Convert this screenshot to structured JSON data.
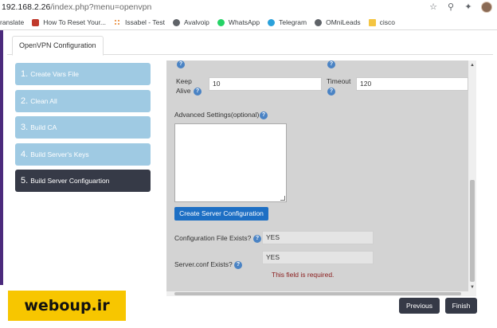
{
  "browser": {
    "url_host": "192.168.2.26",
    "url_path": "/index.php?menu=openvpn",
    "bookmarks": [
      {
        "label": "ranslate",
        "icon": "none"
      },
      {
        "label": "How To Reset Your...",
        "icon": "msft"
      },
      {
        "label": "Issabel - Test",
        "icon": "dots"
      },
      {
        "label": "Avalvoip",
        "icon": "globe"
      },
      {
        "label": "WhatsApp",
        "icon": "wa"
      },
      {
        "label": "Telegram",
        "icon": "tg"
      },
      {
        "label": "OMniLeads",
        "icon": "globe"
      },
      {
        "label": "cisco",
        "icon": "folder"
      }
    ]
  },
  "tab": {
    "label": "OpenVPN Configuration"
  },
  "steps": [
    {
      "num": "1.",
      "label": "Create Vars File"
    },
    {
      "num": "2.",
      "label": "Clean All"
    },
    {
      "num": "3.",
      "label": "Build CA"
    },
    {
      "num": "4.",
      "label": "Build Server's Keys"
    },
    {
      "num": "5.",
      "label": "Build Server Configuartion"
    }
  ],
  "form": {
    "keep_alive_label_1": "Keep",
    "keep_alive_label_2": "Alive",
    "keep_alive_value": "10",
    "timeout_label": "Timeout",
    "timeout_value": "120",
    "advanced_label": "Advanced Settings(optional)",
    "create_button": "Create Server Configuration",
    "config_exists_label": "Configuration File Exists?",
    "config_exists_value": "YES",
    "server_conf_label": "Server.conf Exists?",
    "server_conf_value": "YES",
    "error_text": "This field is required."
  },
  "nav": {
    "previous": "Previous",
    "finish": "Finish"
  },
  "watermark": "weboup.ir",
  "colors": {
    "step": "#9fcae3",
    "active_step": "#363a47",
    "primary": "#1d6fc4",
    "error": "#8b1e1e",
    "watermark_bg": "#f7c600"
  }
}
